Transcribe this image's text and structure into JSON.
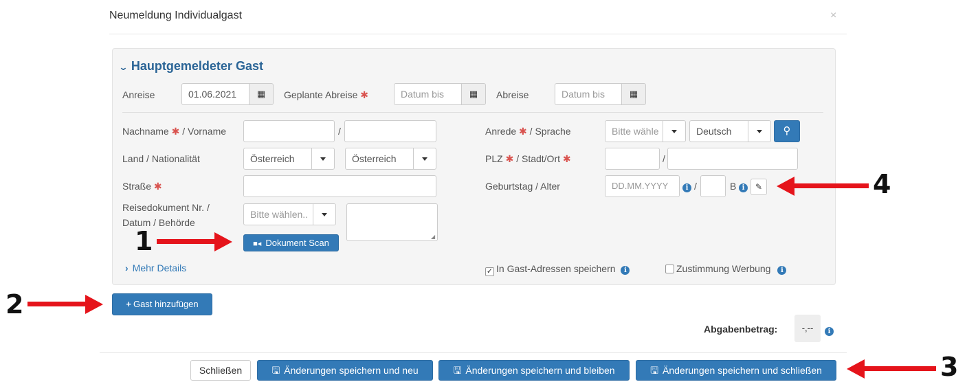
{
  "modal": {
    "title": "Neumeldung Individualgast",
    "close": "×"
  },
  "section": {
    "title": "Hauptgemeldeter Gast"
  },
  "dates": {
    "arrival_label": "Anreise",
    "arrival_value": "01.06.2021",
    "planned_departure_label": "Geplante Abreise",
    "planned_departure_placeholder": "Datum bis",
    "departure_label": "Abreise",
    "departure_placeholder": "Datum bis"
  },
  "form": {
    "name_label_a": "Nachname",
    "name_label_b": " / Vorname",
    "slash": "/",
    "country_label": "Land / Nationalität",
    "country_value": "Österreich",
    "nationality_value": "Österreich",
    "street_label": "Straße",
    "doc_label_line1": "Reisedokument Nr. /",
    "doc_label_line2": "Datum / Behörde",
    "doc_select": "Bitte wählen..",
    "scan_button": "Dokument Scan",
    "salutation_label_a": "Anrede",
    "salutation_label_b": " / Sprache",
    "salutation_select": "Bitte wähle",
    "language_select": "Deutsch",
    "zip_label_a": "PLZ",
    "zip_label_b": " / Stadt/Ort",
    "birthday_label": "Geburtstag / Alter",
    "birthday_placeholder": "DD.MM.YYYY",
    "age_suffix": "B",
    "more_details": "Mehr Details",
    "save_address_label": "In Gast-Adressen speichern",
    "save_address_checked": true,
    "consent_label": "Zustimmung Werbung",
    "consent_checked": false
  },
  "add_guest_button": "Gast hinzufügen",
  "fee": {
    "label": "Abgabenbetrag:",
    "value": "-,--"
  },
  "footer": {
    "close": "Schließen",
    "save_new": "Änderungen speichern und neu",
    "save_stay": "Änderungen speichern und bleiben",
    "save_close": "Änderungen speichern und schließen"
  },
  "annotations": {
    "m1": "1",
    "m2": "2",
    "m3": "3",
    "m4": "4",
    "color": "#e5141b"
  },
  "colors": {
    "primary": "#337ab7",
    "required": "#d9534f",
    "panel": "#f5f5f5"
  }
}
